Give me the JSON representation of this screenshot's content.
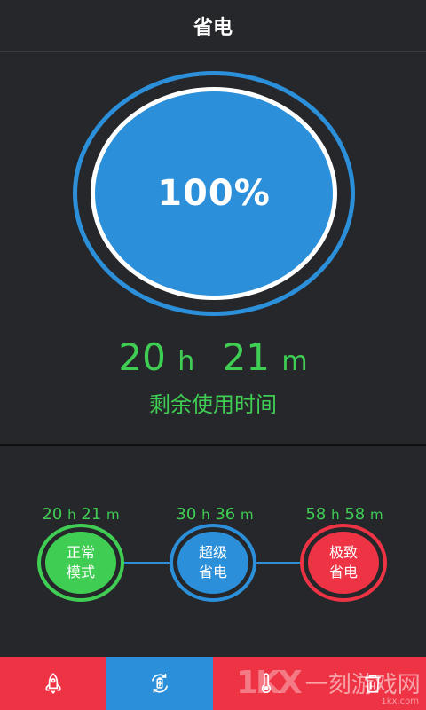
{
  "header": {
    "title": "省电"
  },
  "battery": {
    "percent": "100%"
  },
  "remaining": {
    "hours": "20",
    "hours_unit": "h",
    "minutes": "21",
    "minutes_unit": "m",
    "label": "剩余使用时间"
  },
  "modes": [
    {
      "name": "正常\n模式",
      "hours": "20",
      "minutes": "21",
      "color": "#3fce53"
    },
    {
      "name": "超级\n省电",
      "hours": "30",
      "minutes": "36",
      "color": "#2b8fd9"
    },
    {
      "name": "极致\n省电",
      "hours": "58",
      "minutes": "58",
      "color": "#ee3344"
    }
  ],
  "units": {
    "h": "h",
    "m": "m"
  },
  "bottom_nav": [
    {
      "icon": "rocket-icon"
    },
    {
      "icon": "battery-cycle-icon",
      "active": true
    },
    {
      "icon": "thermometer-icon"
    },
    {
      "icon": "trash-icon"
    }
  ],
  "watermark": {
    "logo": "1KX",
    "text": "一刻游戏网",
    "url": "1kx.com"
  },
  "colors": {
    "background": "#26272b",
    "accent_blue": "#2b8fd9",
    "green": "#3fce53",
    "red": "#ee3344"
  }
}
